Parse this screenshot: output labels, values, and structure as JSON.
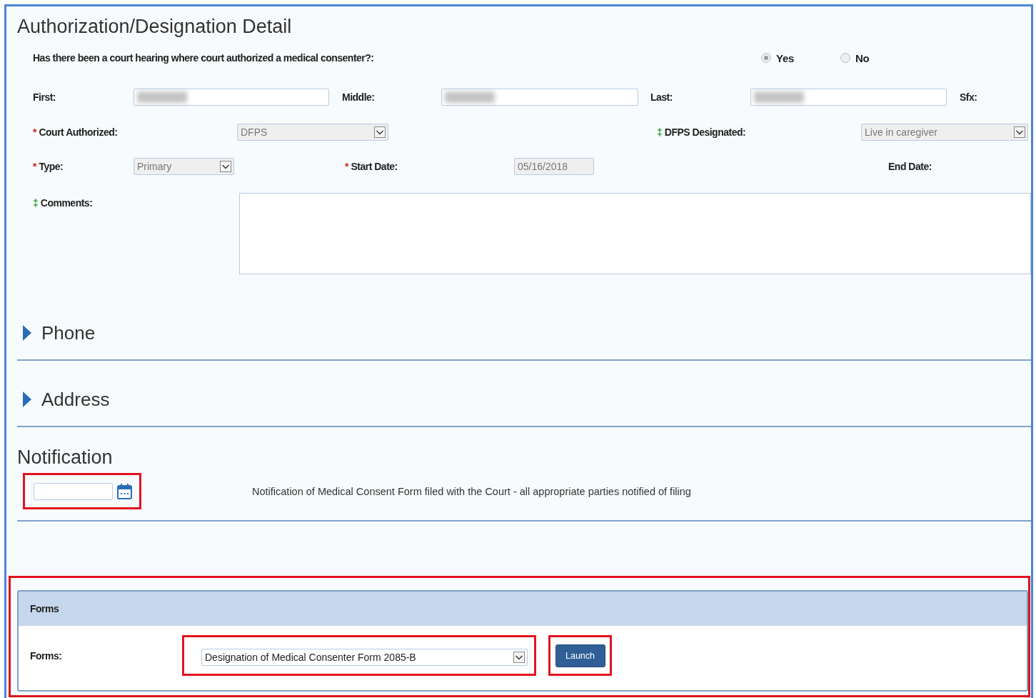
{
  "title": "Authorization/Designation Detail",
  "question": {
    "label": "Has there been a court hearing where court authorized a medical consenter?:",
    "options": [
      {
        "label": "Yes",
        "selected": true,
        "disabled": true
      },
      {
        "label": "No",
        "selected": false,
        "disabled": true
      }
    ]
  },
  "name_fields": [
    {
      "label": "First:",
      "redacted": true
    },
    {
      "label": "Middle:",
      "redacted": true
    },
    {
      "label": "Last:",
      "redacted": true
    },
    {
      "label": "Sfx:"
    }
  ],
  "court_authorized": {
    "marker": {
      "symbol": "*",
      "kind": "required"
    },
    "label": "Court Authorized:",
    "value": "DFPS",
    "disabled": true
  },
  "dfps_designated": {
    "marker": {
      "symbol": "‡",
      "kind": "conditional"
    },
    "label": "DFPS Designated:",
    "value": "Live in caregiver",
    "disabled": true
  },
  "type": {
    "marker": {
      "symbol": "*",
      "kind": "required"
    },
    "label": "Type:",
    "value": "Primary",
    "disabled": true
  },
  "start_date": {
    "marker": {
      "symbol": "*",
      "kind": "required"
    },
    "label": "Start Date:",
    "value": "05/16/2018",
    "disabled": true
  },
  "end_date": {
    "label": "End Date:"
  },
  "comments": {
    "marker": {
      "symbol": "‡",
      "kind": "conditional"
    },
    "label": "Comments:"
  },
  "sections": [
    {
      "title": "Phone",
      "expanded": false
    },
    {
      "title": "Address",
      "expanded": false
    }
  ],
  "notification": {
    "title": "Notification",
    "date_highlighted": true,
    "description": "Notification of Medical Consent Form filed with the Court - all appropriate parties notified of filing"
  },
  "forms_panel": {
    "highlighted": true,
    "header": "Forms",
    "label": "Forms:",
    "select": {
      "value": "Designation of Medical Consenter Form 2085-B",
      "highlighted": true
    },
    "launch": {
      "label": "Launch",
      "highlighted": true
    }
  }
}
